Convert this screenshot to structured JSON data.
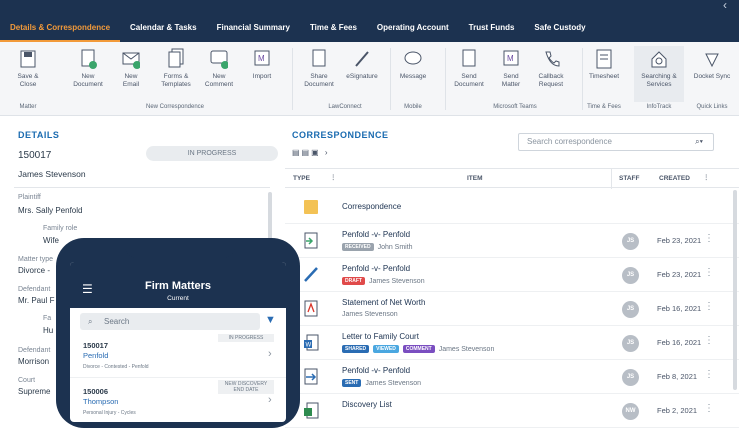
{
  "tabs": [
    "Details & Correspondence",
    "Calendar & Tasks",
    "Financial Summary",
    "Time & Fees",
    "Operating Account",
    "Trust Funds",
    "Safe Custody"
  ],
  "ribbon": {
    "buttons": [
      "Save &\nClose",
      "New\nDocument",
      "New\nEmail",
      "Forms &\nTemplates",
      "New\nComment",
      "Import",
      "Share\nDocument",
      "eSignature",
      "Message",
      "Send\nDocument",
      "Send\nMatter",
      "Callback\nRequest",
      "Timesheet",
      "Searching &\nServices",
      "Docket Sync"
    ],
    "groups": [
      "Matter",
      "New Correspondence",
      "LawConnect",
      "Mobile",
      "Microsoft Teams",
      "Time & Fees",
      "InfoTrack",
      "Quick Links"
    ]
  },
  "details": {
    "heading": "DETAILS",
    "matter_no": "150017",
    "status": "IN PROGRESS",
    "client": "James Stevenson",
    "plaintiff_label": "Plaintiff",
    "plaintiff": "Mrs. Sally Penfold",
    "family_role_label": "Family role",
    "family_role": "Wife",
    "matter_type_label": "Matter type",
    "matter_type": "Divorce -",
    "defendant_label": "Defendant",
    "defendant": "Mr. Paul F",
    "fa_label": "Fa",
    "hu": "Hu",
    "defendant2_label": "Defendant",
    "defendant2": "Morrison",
    "court_label": "Court",
    "court": "Supreme"
  },
  "corr": {
    "heading": "CORRESPONDENCE",
    "search_placeholder": "Search correspondence",
    "cols": {
      "type": "TYPE",
      "item": "ITEM",
      "staff": "STAFF",
      "created": "CREATED"
    },
    "folder": "Correspondence",
    "rows": [
      {
        "title": "Penfold -v- Penfold",
        "tag": "RECEIVED",
        "tagcolor": "#9aa3ad",
        "who": "John Smith",
        "staff": "JS",
        "date": "Feb 23, 2021"
      },
      {
        "title": "Penfold -v- Penfold",
        "tag": "DRAFT",
        "tagcolor": "#e04a4a",
        "who": "James Stevenson",
        "staff": "JS",
        "date": "Feb 23, 2021"
      },
      {
        "title": "Statement of Net Worth",
        "tag": "",
        "tagcolor": "",
        "who": "James Stevenson",
        "staff": "JS",
        "date": "Feb 16, 2021"
      },
      {
        "title": "Letter to Family Court",
        "tag": "SHARED",
        "tagcolor": "#2a6cb3",
        "tag2": "VIEWED",
        "tag3": "COMMENT",
        "who": "James Stevenson",
        "staff": "JS",
        "date": "Feb 16, 2021"
      },
      {
        "title": "Penfold -v- Penfold",
        "tag": "SENT",
        "tagcolor": "#2a6cb3",
        "who": "James Stevenson",
        "staff": "JS",
        "date": "Feb 8, 2021"
      },
      {
        "title": "Discovery List",
        "tag": "",
        "tagcolor": "",
        "who": "",
        "staff": "NW",
        "date": "Feb 2, 2021"
      }
    ]
  },
  "phone": {
    "title": "Firm Matters",
    "subtitle": "Current",
    "search_placeholder": "Search",
    "items": [
      {
        "status": "IN PROGRESS",
        "no": "150017",
        "name": "Penfold",
        "desc": "Divorce - Contested - Penfold"
      },
      {
        "status": "NEW DISCOVERY\nEND DATE",
        "no": "150006",
        "name": "Thompson",
        "desc": "Personal Injury - Cycles"
      }
    ]
  }
}
